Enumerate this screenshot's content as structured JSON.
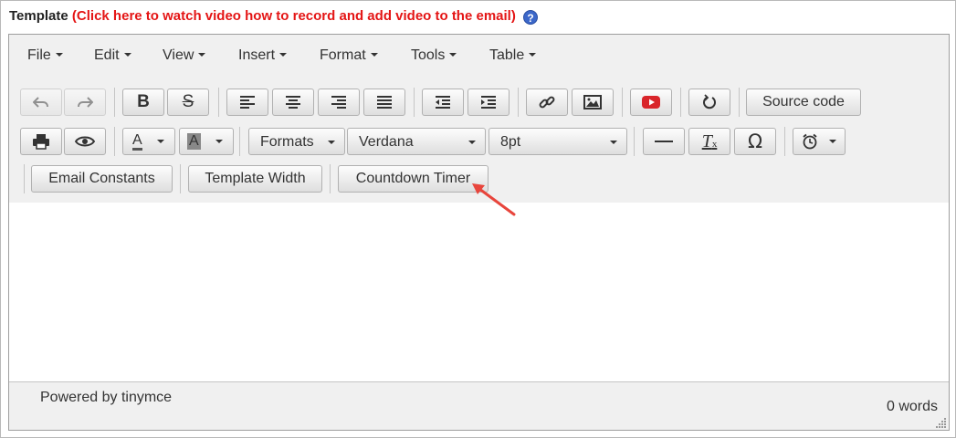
{
  "header": {
    "label": "Template",
    "link_text": "(Click here to watch video how to record and add video to the email)",
    "help_icon": "question-circle-icon",
    "link_color": "#e41515"
  },
  "menubar": {
    "items": [
      {
        "label": "File"
      },
      {
        "label": "Edit"
      },
      {
        "label": "View"
      },
      {
        "label": "Insert"
      },
      {
        "label": "Format"
      },
      {
        "label": "Tools"
      },
      {
        "label": "Table"
      }
    ]
  },
  "toolbar": {
    "icons": [
      "undo-icon",
      "redo-icon",
      "bold-icon",
      "strikethrough-icon",
      "align-left-icon",
      "align-center-icon",
      "align-right-icon",
      "align-justify-icon",
      "outdent-icon",
      "indent-icon",
      "link-icon",
      "image-icon",
      "youtube-icon",
      "restore-icon",
      "print-icon",
      "preview-icon",
      "text-color-icon",
      "background-color-icon",
      "horizontal-rule-icon",
      "clear-formatting-icon",
      "special-character-icon",
      "alarm-clock-icon"
    ],
    "source_code_label": "Source code",
    "formats_label": "Formats",
    "font_family": "Verdana",
    "font_size": "8pt",
    "email_constants_label": "Email Constants",
    "template_width_label": "Template Width",
    "countdown_timer_label": "Countdown Timer"
  },
  "annotation": {
    "arrow_icon": "red-arrow-icon",
    "color": "#e8453c"
  },
  "statusbar": {
    "powered_by": "Powered by tinymce",
    "word_count": "0 words"
  }
}
